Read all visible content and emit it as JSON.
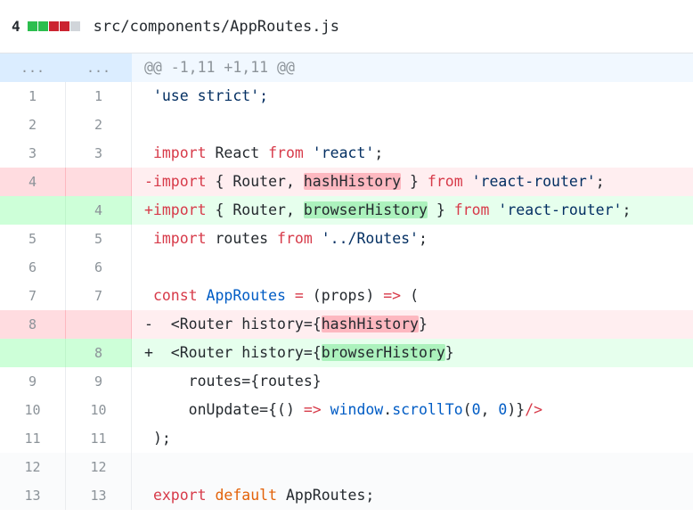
{
  "file": {
    "changes": "4",
    "path": "src/components/AppRoutes.js",
    "diffstat_colors": [
      "#2cbe4e",
      "#2cbe4e",
      "#cb2431",
      "#cb2431",
      "#d1d5da"
    ]
  },
  "hunk": {
    "old_marker": "...",
    "new_marker": "...",
    "header": "@@ -1,11 +1,11 @@"
  },
  "lines": [
    {
      "old": "1",
      "new": "1",
      "t": [
        "'use strict';"
      ]
    },
    {
      "old": "2",
      "new": "2",
      "t": []
    },
    {
      "old": "3",
      "new": "3",
      "t": [
        "import",
        "React",
        "from",
        "'react'",
        ";"
      ]
    },
    {
      "old": "4",
      "new": "",
      "t": [
        "-import",
        "{ Router,",
        "hashHistory",
        "}",
        "from",
        "'react-router'",
        ";"
      ]
    },
    {
      "old": "",
      "new": "4",
      "t": [
        "+import",
        "{ Router,",
        "browserHistory",
        "}",
        "from",
        "'react-router'",
        ";"
      ]
    },
    {
      "old": "5",
      "new": "5",
      "t": [
        "import",
        "routes",
        "from",
        "'../Routes'",
        ";"
      ]
    },
    {
      "old": "6",
      "new": "6",
      "t": []
    },
    {
      "old": "7",
      "new": "7",
      "t": [
        "const",
        "AppRoutes",
        "=",
        "(props)",
        "=>",
        "("
      ]
    },
    {
      "old": "8",
      "new": "",
      "t": [
        "-  <",
        "Router",
        "history=",
        "{",
        "hashHistory",
        "}"
      ]
    },
    {
      "old": "",
      "new": "8",
      "t": [
        "+  <",
        "Router",
        "history=",
        "{",
        "browserHistory",
        "}"
      ]
    },
    {
      "old": "9",
      "new": "9",
      "t": [
        "routes=",
        "{routes}"
      ]
    },
    {
      "old": "10",
      "new": "10",
      "t": [
        "onUpdate=",
        "{() ",
        "=>",
        "window",
        ".",
        "scrollTo",
        "(",
        "0",
        ", ",
        "0",
        ")}",
        "/>"
      ]
    },
    {
      "old": "11",
      "new": "11",
      "t": [
        ");"
      ]
    },
    {
      "old": "12",
      "new": "12",
      "t": []
    },
    {
      "old": "13",
      "new": "13",
      "t": [
        "export",
        "default",
        "AppRoutes;"
      ]
    }
  ]
}
